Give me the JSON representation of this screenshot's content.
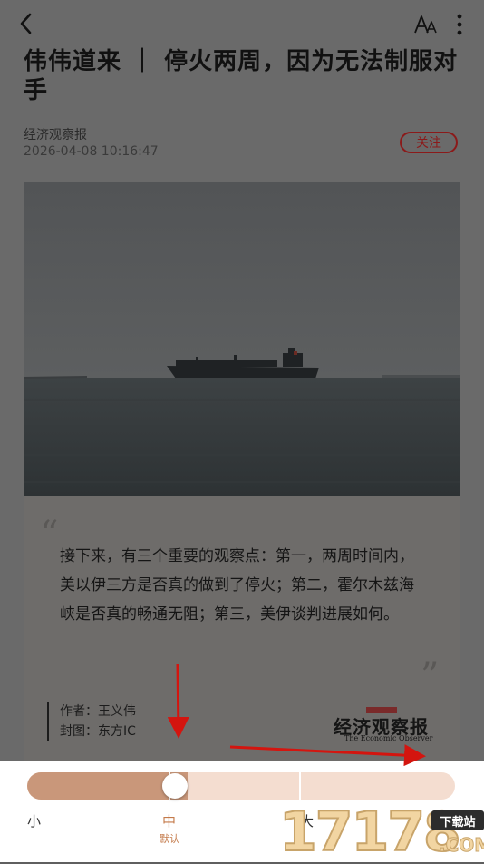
{
  "header": {
    "back_icon": "chevron-left-icon",
    "font_size_icon": "font-size-icon",
    "font_size_label": "AA",
    "more_icon": "more-vertical-icon"
  },
  "article": {
    "title": "伟伟道来 ｜ 停火两周，因为无法制服对手",
    "source": "经济观察报",
    "datetime": "2026-04-08 10:16:47",
    "follow_label": "关注"
  },
  "quote_card": {
    "open_mark": "“",
    "close_mark": "”",
    "text": "接下来，有三个重要的观察点：第一，两周时间内，美以伊三方是否真的做到了停火；第二，霍尔木兹海峡是否真的畅通无阻；第三，美伊谈判进展如何。",
    "author": "作者：王义伟",
    "cover": "封图：东方IC",
    "logo_name": "经济观察报",
    "logo_en": "The Economic Observer"
  },
  "font_panel": {
    "levels": [
      "小",
      "中",
      "大",
      "特大"
    ],
    "selected_index": 1,
    "default_label": "默认",
    "accent_color": "#c9977a",
    "track_color": "#f4ddd0"
  },
  "watermark": {
    "number": "17178",
    "tag": "下载站",
    "suffix": ".COM"
  }
}
